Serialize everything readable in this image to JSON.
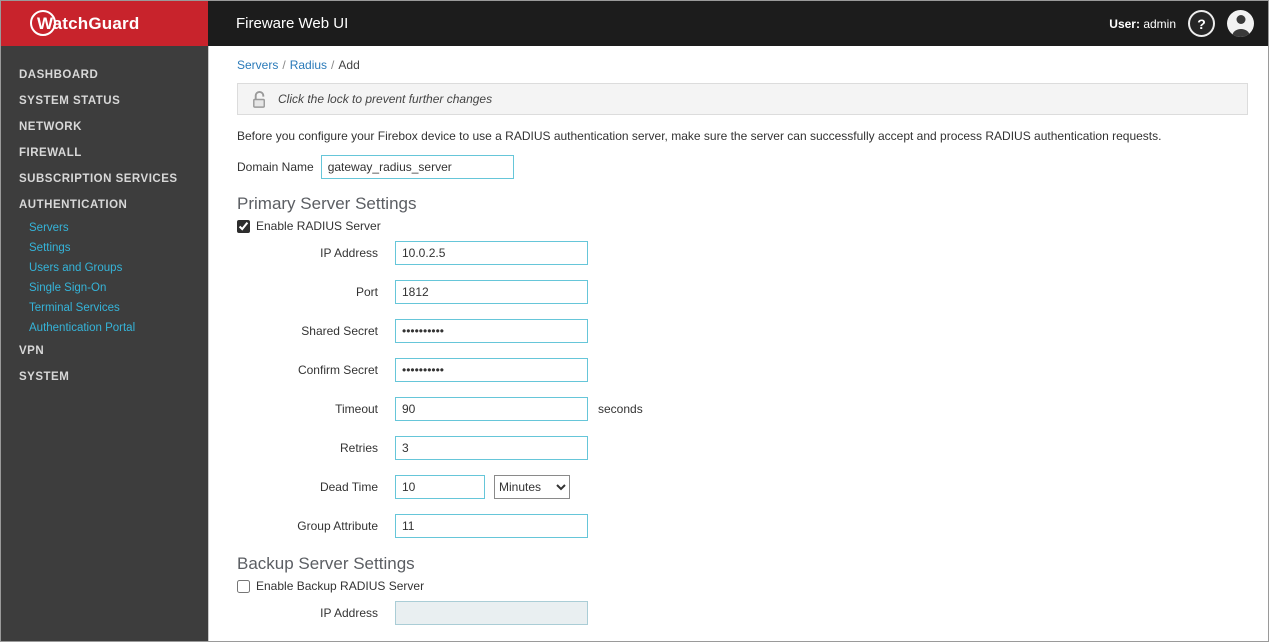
{
  "colors": {
    "brand_red": "#c8232c",
    "topbar_dark": "#1c1c1c",
    "sidebar_gray": "#3d3d3d",
    "input_border_cyan": "#66c6d9",
    "sidebar_link_cyan": "#35b4d9",
    "breadcrumb_link_blue": "#2a7ab9",
    "section_heading_gray": "#5b5e63"
  },
  "header": {
    "brand": "WatchGuard",
    "title": "Fireware Web UI",
    "user_label": "User:",
    "user_name": "admin",
    "help_glyph": "?"
  },
  "sidebar": {
    "items": [
      {
        "label": "DASHBOARD"
      },
      {
        "label": "SYSTEM STATUS"
      },
      {
        "label": "NETWORK"
      },
      {
        "label": "FIREWALL"
      },
      {
        "label": "SUBSCRIPTION SERVICES"
      },
      {
        "label": "AUTHENTICATION"
      },
      {
        "label": "VPN"
      },
      {
        "label": "SYSTEM"
      }
    ],
    "auth_children": [
      {
        "label": "Servers"
      },
      {
        "label": "Settings"
      },
      {
        "label": "Users and Groups"
      },
      {
        "label": "Single Sign-On"
      },
      {
        "label": "Terminal Services"
      },
      {
        "label": "Authentication Portal"
      }
    ]
  },
  "breadcrumb": {
    "links": [
      "Servers",
      "Radius"
    ],
    "current": "Add",
    "separator": "/"
  },
  "form": {
    "lock_notice": "Click the lock to prevent further changes",
    "intro": "Before you configure your Firebox device to use a RADIUS authentication server, make sure the server can successfully accept and process RADIUS authentication requests.",
    "domain_name": {
      "label": "Domain Name",
      "value": "gateway_radius_server"
    },
    "primary": {
      "heading": "Primary Server Settings",
      "enable": {
        "label": "Enable RADIUS Server",
        "checked": true
      },
      "ip": {
        "label": "IP Address",
        "value": "10.0.2.5"
      },
      "port": {
        "label": "Port",
        "value": "1812"
      },
      "shared_secret": {
        "label": "Shared Secret",
        "value": "••••••••••"
      },
      "confirm_secret": {
        "label": "Confirm Secret",
        "value": "••••••••••"
      },
      "timeout": {
        "label": "Timeout",
        "value": "90",
        "suffix": "seconds"
      },
      "retries": {
        "label": "Retries",
        "value": "3"
      },
      "dead_time": {
        "label": "Dead Time",
        "value": "10",
        "unit": "Minutes"
      },
      "group_attribute": {
        "label": "Group Attribute",
        "value": "11"
      }
    },
    "backup": {
      "heading": "Backup Server Settings",
      "enable": {
        "label": "Enable Backup RADIUS Server",
        "checked": false
      },
      "ip": {
        "label": "IP Address",
        "value": ""
      }
    }
  }
}
